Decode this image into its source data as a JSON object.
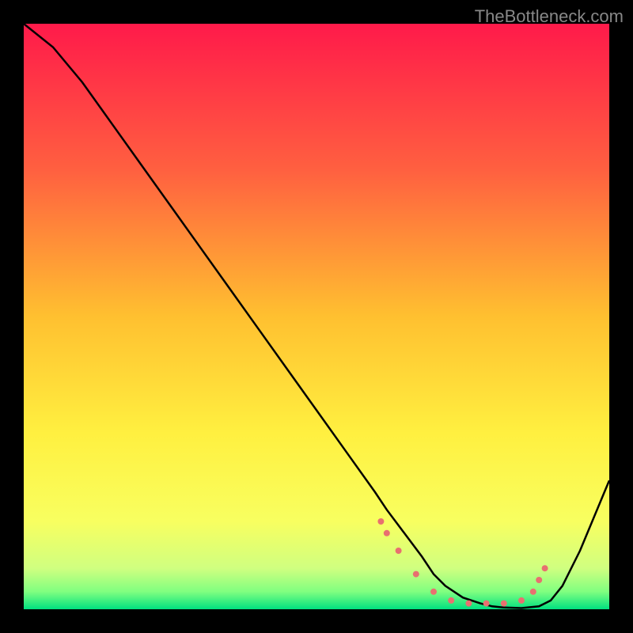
{
  "watermark": "TheBottleneck.com",
  "chart_data": {
    "type": "line",
    "title": "",
    "xlabel": "",
    "ylabel": "",
    "xlim": [
      0,
      100
    ],
    "ylim": [
      0,
      100
    ],
    "gradient_stops": [
      {
        "offset": 0,
        "color": "#ff1a4a"
      },
      {
        "offset": 0.25,
        "color": "#ff6040"
      },
      {
        "offset": 0.5,
        "color": "#ffc030"
      },
      {
        "offset": 0.7,
        "color": "#fff040"
      },
      {
        "offset": 0.85,
        "color": "#f8ff60"
      },
      {
        "offset": 0.93,
        "color": "#d0ff80"
      },
      {
        "offset": 0.97,
        "color": "#80ff80"
      },
      {
        "offset": 1.0,
        "color": "#00e080"
      }
    ],
    "curve": {
      "x": [
        0,
        5,
        10,
        15,
        20,
        25,
        30,
        35,
        40,
        45,
        50,
        55,
        60,
        62,
        65,
        68,
        70,
        72,
        75,
        78,
        80,
        82,
        85,
        88,
        90,
        92,
        95,
        100
      ],
      "y": [
        100,
        96,
        90,
        83,
        76,
        69,
        62,
        55,
        48,
        41,
        34,
        27,
        20,
        17,
        13,
        9,
        6,
        4,
        2,
        1,
        0.5,
        0.3,
        0.2,
        0.5,
        1.5,
        4,
        10,
        22
      ]
    },
    "markers": {
      "x": [
        61,
        62,
        64,
        67,
        70,
        73,
        76,
        79,
        82,
        85,
        87,
        88,
        89
      ],
      "y": [
        15,
        13,
        10,
        6,
        3,
        1.5,
        1,
        1,
        1,
        1.5,
        3,
        5,
        7
      ],
      "color": "#e87070",
      "size": 8
    }
  }
}
